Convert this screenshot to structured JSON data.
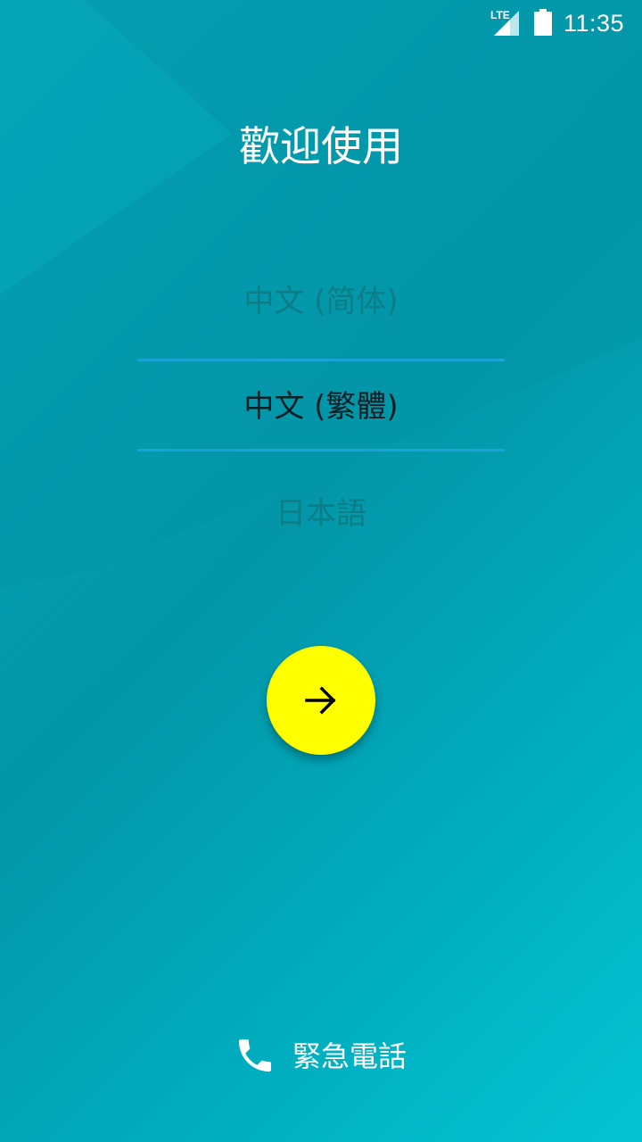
{
  "status_bar": {
    "network_label": "LTE",
    "time": "11:35"
  },
  "welcome": {
    "title": "歡迎使用"
  },
  "language_picker": {
    "options": [
      "中文 (简体)",
      "中文 (繁體)",
      "日本語"
    ],
    "selected": "中文 (繁體)"
  },
  "next_button": {
    "icon": "arrow-right-icon"
  },
  "emergency": {
    "label": "緊急電話",
    "icon": "phone-icon"
  },
  "colors": {
    "background": "#0396a8",
    "accent": "#ffff00",
    "divider": "#1ba3d6",
    "text_primary": "#ffffff",
    "text_dim": "#0a7d86",
    "text_selected": "#0c1f24"
  }
}
